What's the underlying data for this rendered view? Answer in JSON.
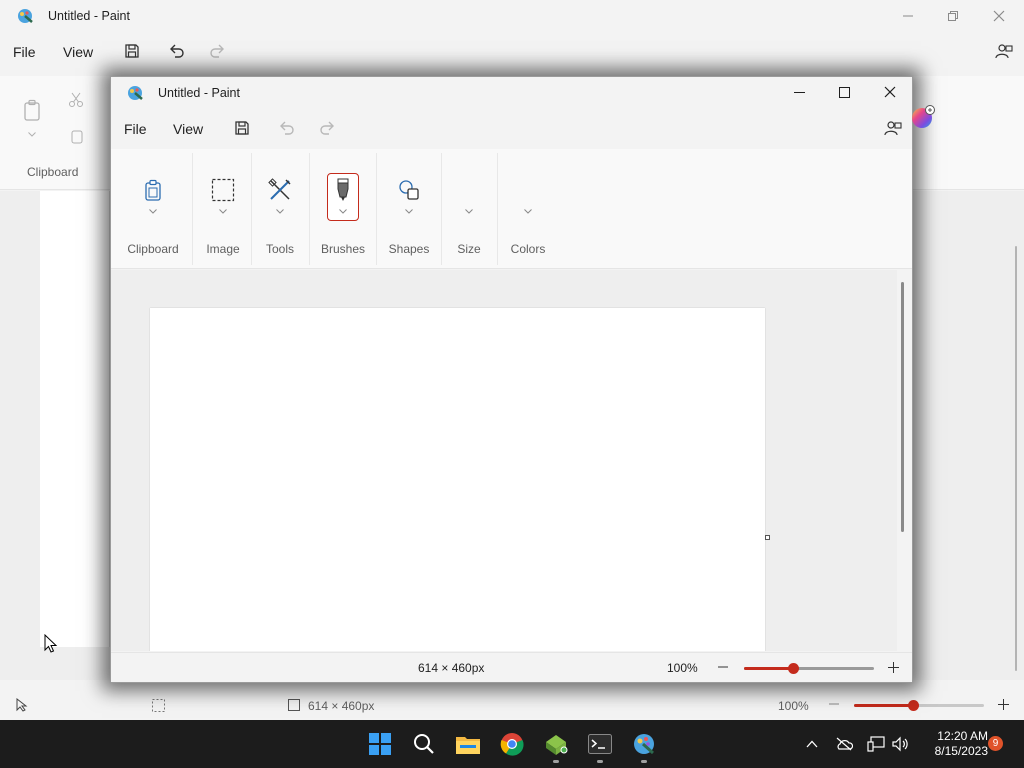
{
  "background_window": {
    "title": "Untitled - Paint",
    "menu": {
      "file": "File",
      "view": "View"
    },
    "ribbon": {
      "clipboard_label": "Clipboard"
    },
    "status": {
      "canvas_size": "614 × 460px",
      "zoom": "100%",
      "zoom_fraction": 0.45
    }
  },
  "window": {
    "title": "Untitled - Paint",
    "menu": {
      "file": "File",
      "view": "View"
    },
    "ribbon": {
      "groups": [
        {
          "label": "Clipboard",
          "icon": "clipboard-icon"
        },
        {
          "label": "Image",
          "icon": "select-rectangle-icon"
        },
        {
          "label": "Tools",
          "icon": "tools-icon"
        },
        {
          "label": "Brushes",
          "icon": "brush-icon"
        },
        {
          "label": "Shapes",
          "icon": "shapes-icon"
        },
        {
          "label": "Size",
          "icon": "chevron-down-icon"
        },
        {
          "label": "Colors",
          "icon": "chevron-down-icon"
        }
      ]
    },
    "status": {
      "canvas_size": "614 × 460px",
      "zoom": "100%",
      "zoom_fraction": 0.38
    }
  },
  "taskbar": {
    "apps": [
      "start-icon",
      "search-icon",
      "file-explorer-icon",
      "chrome-icon",
      "green-app-icon",
      "terminal-icon",
      "paint-icon"
    ],
    "time": "12:20 AM",
    "date": "8/15/2023",
    "notification_count": "9"
  },
  "colors": {
    "accent": "#c42b1c",
    "taskbar": "#1c1c1c",
    "start_blue": "#0f6cbd"
  }
}
